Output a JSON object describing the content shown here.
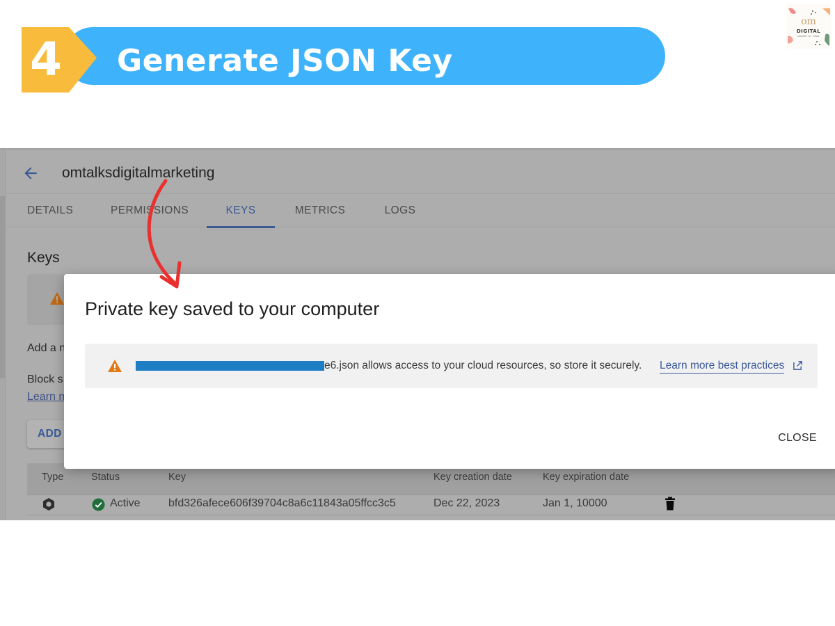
{
  "banner": {
    "step_number": "4",
    "title": "Generate JSON Key",
    "pill_color": "#3eb3fb",
    "badge_color": "#f8bb3c"
  },
  "logo": {
    "mark": "om",
    "name": "DIGITAL",
    "tagline": "MARKET BY TIERS"
  },
  "console": {
    "service_account": "omtalksdigitalmarketing",
    "back_icon": "arrow-left-icon",
    "tabs": [
      {
        "label": "DETAILS",
        "active": false
      },
      {
        "label": "PERMISSIONS",
        "active": false
      },
      {
        "label": "KEYS",
        "active": true
      },
      {
        "label": "METRICS",
        "active": false
      },
      {
        "label": "LOGS",
        "active": false
      }
    ],
    "section_title": "Keys",
    "add_text_partial": "Add a n",
    "block_text_partial": "Block s",
    "learn_link_partial": "Learn m",
    "add_key_button_partial": "ADD I",
    "table": {
      "columns": [
        "Type",
        "Status",
        "Key",
        "Key creation date",
        "Key expiration date"
      ],
      "rows": [
        {
          "type_icon": "service-account-key-icon",
          "status": "Active",
          "key": "bfd326afece606f39704c8a6c11843a05ffcc3c5",
          "created": "Dec 22, 2023",
          "expires": "Jan 1, 10000"
        }
      ]
    }
  },
  "dialog": {
    "title": "Private key saved to your computer",
    "notice_text": "e6.json allows access to your cloud resources, so store it securely.",
    "notice_link": "Learn more best practices",
    "close_label": "CLOSE"
  },
  "colors": {
    "accent_blue": "#3a5a96",
    "warning_orange": "#e07b14",
    "active_green": "#1e8e3e",
    "annotation_red": "#e8302e"
  }
}
